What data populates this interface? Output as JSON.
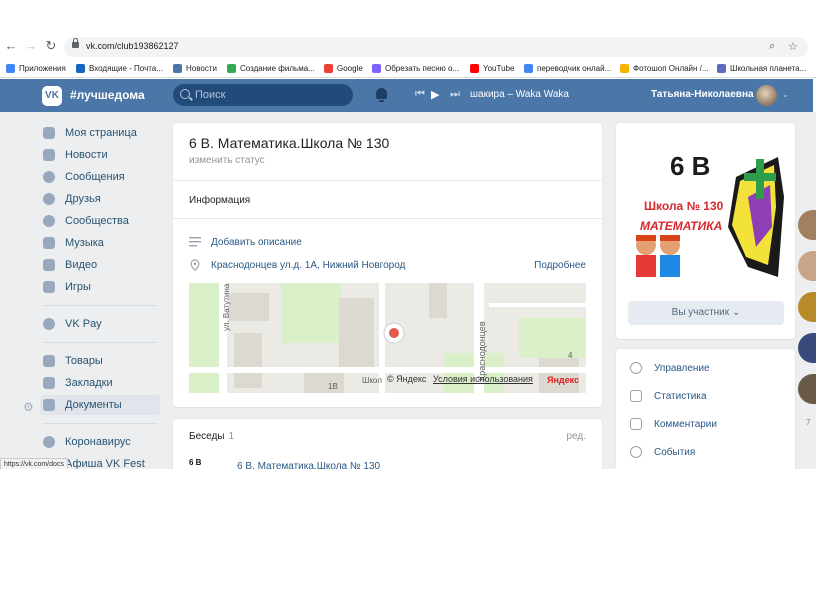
{
  "browser": {
    "url": "vk.com/club193862127",
    "bookmarks": [
      {
        "label": "Приложения",
        "color": "#4285f4"
      },
      {
        "label": "Входящие - Почта...",
        "color": "#1565c0"
      },
      {
        "label": "Новости",
        "color": "#4a76a8"
      },
      {
        "label": "Создание фильма...",
        "color": "#34a853"
      },
      {
        "label": "Google",
        "color": "#ea4335"
      },
      {
        "label": "Обрезать песню о...",
        "color": "#7b61ff"
      },
      {
        "label": "YouTube",
        "color": "#ff0000"
      },
      {
        "label": "переводчик онлай...",
        "color": "#4285f4"
      },
      {
        "label": "Фотошоп Онлайн /...",
        "color": "#f4b400"
      },
      {
        "label": "Школьная планета...",
        "color": "#5c6bc0"
      }
    ],
    "status_url": "https://vk.com/docs"
  },
  "header": {
    "logo": "VK",
    "hashtag": "#лучшедома",
    "search_placeholder": "Поиск",
    "track": "шакира – Waka Waka",
    "username": "Татьяна-Николаевна"
  },
  "menu": {
    "items": [
      {
        "label": "Моя страница",
        "icon": "home-icon"
      },
      {
        "label": "Новости",
        "icon": "news-icon"
      },
      {
        "label": "Сообщения",
        "icon": "messages-icon"
      },
      {
        "label": "Друзья",
        "icon": "friends-icon"
      },
      {
        "label": "Сообщества",
        "icon": "communities-icon"
      },
      {
        "label": "Музыка",
        "icon": "music-icon"
      },
      {
        "label": "Видео",
        "icon": "video-icon"
      },
      {
        "label": "Игры",
        "icon": "games-icon"
      },
      {
        "label": "VK Pay",
        "icon": "vkpay-icon"
      },
      {
        "label": "Товары",
        "icon": "goods-icon"
      },
      {
        "label": "Закладки",
        "icon": "bookmarks-icon"
      },
      {
        "label": "Документы",
        "icon": "documents-icon"
      },
      {
        "label": "Коронавирус",
        "icon": "coronavirus-icon"
      },
      {
        "label": "Афиша VK Fest",
        "icon": "fest-icon"
      }
    ]
  },
  "group": {
    "title": "6 В. Математика.Школа № 130",
    "status": "изменить статус",
    "tab": "Информация",
    "add_description": "Добавить описание",
    "address": "Краснодонцев ул.д. 1А, Нижний Новгород",
    "more": "Подробнее",
    "map": {
      "street1": "ул. Ватутина",
      "street2": "Краснодонцев",
      "label1": "1В",
      "label2": "Школ",
      "label3": "4",
      "copyright": "© Яндекс",
      "terms": "Условия использования",
      "brand": "Яндекс"
    },
    "chats": {
      "title": "Беседы",
      "count": "1",
      "edit": "ред.",
      "chat_name": "6 В. Математика.Школа № 130"
    }
  },
  "sidebar_right": {
    "cover_title": "6 В",
    "cover_school": "Школа № 130",
    "cover_subject": "МАТЕМАТИКА",
    "member_button": "Вы участник",
    "manage_items": [
      "Управление",
      "Статистика",
      "Комментарии",
      "События"
    ],
    "strip_count": "7"
  }
}
